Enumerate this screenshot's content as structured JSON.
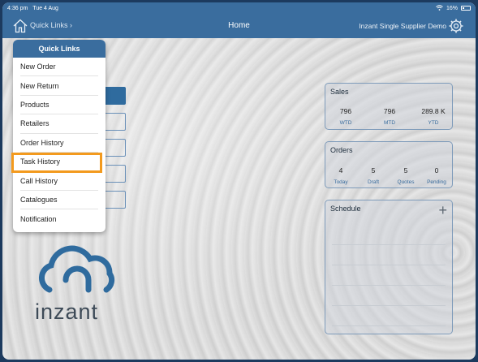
{
  "status": {
    "time": "4:36 pm",
    "date": "Tue 4 Aug",
    "battery": "16%"
  },
  "nav": {
    "quick_links": "Quick Links ›",
    "title": "Home",
    "company": "Inzant Single Supplier Demo"
  },
  "quick_links_menu": {
    "header": "Quick Links",
    "items": [
      {
        "label": "New Order"
      },
      {
        "label": "New Return"
      },
      {
        "label": "Products"
      },
      {
        "label": "Retailers"
      },
      {
        "label": "Order History"
      },
      {
        "label": "Task History"
      },
      {
        "label": "Call History"
      },
      {
        "label": "Catalogues"
      },
      {
        "label": "Notification"
      }
    ],
    "highlighted": "Task History"
  },
  "sales": {
    "title": "Sales",
    "stats": [
      {
        "value": "796",
        "label": "WTD"
      },
      {
        "value": "796",
        "label": "MTD"
      },
      {
        "value": "289.8 K",
        "label": "YTD"
      }
    ]
  },
  "orders": {
    "title": "Orders",
    "stats": [
      {
        "value": "4",
        "label": "Today"
      },
      {
        "value": "5",
        "label": "Draft"
      },
      {
        "value": "5",
        "label": "Quotes"
      },
      {
        "value": "0",
        "label": "Pending"
      }
    ]
  },
  "schedule": {
    "title": "Schedule",
    "add_symbol": "+"
  },
  "logo": {
    "text": "inzant"
  },
  "colors": {
    "nav": "#3a6d9e",
    "highlight": "#f39a1e",
    "logo_blue": "#2f6b9e"
  }
}
